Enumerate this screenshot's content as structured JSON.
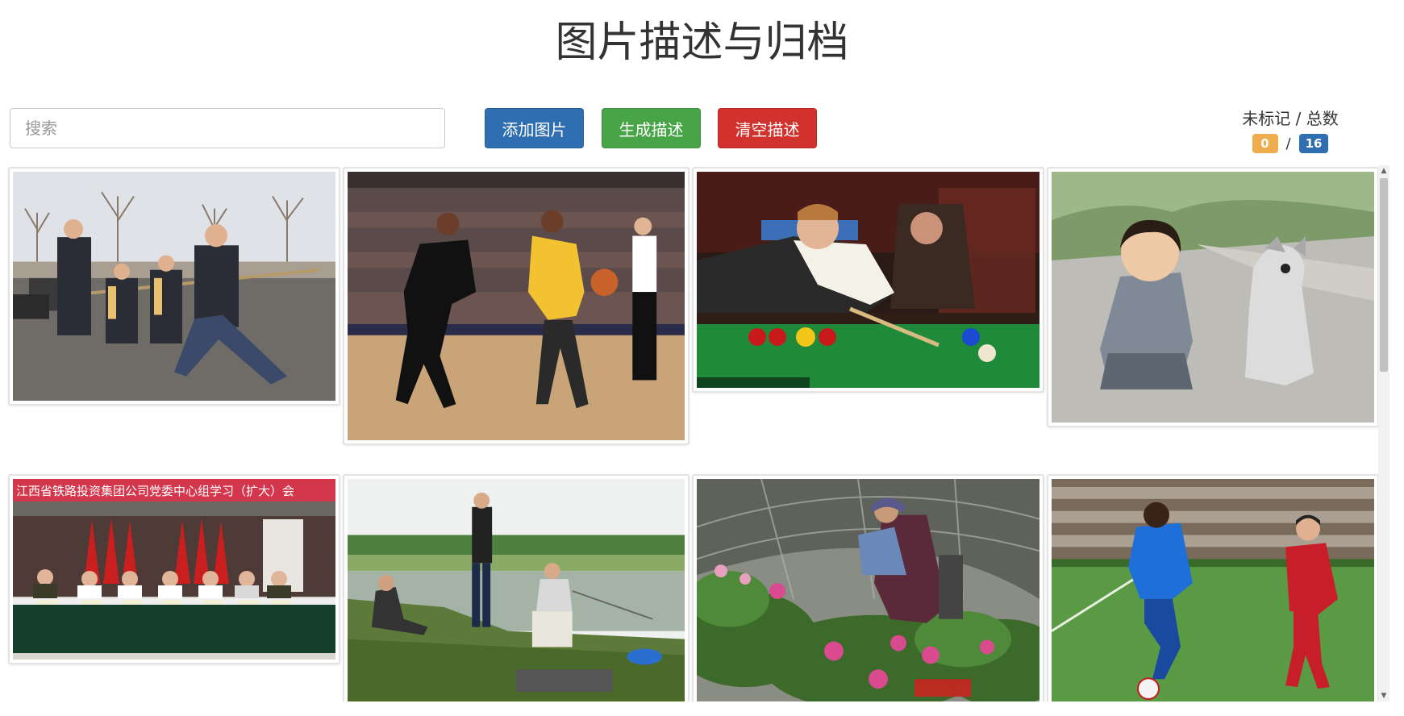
{
  "app": {
    "title": "图片描述与归档"
  },
  "toolbar": {
    "search_placeholder": "搜索",
    "add_label": "添加图片",
    "generate_label": "生成描述",
    "clear_label": "清空描述"
  },
  "counter": {
    "label": "未标记 / 总数",
    "unmarked": "0",
    "separator": "/",
    "total": "16"
  },
  "colors": {
    "add_button": "#2f6eb0",
    "generate_button": "#47a447",
    "clear_button": "#d2322d",
    "badge_unmarked": "#f0ad4e",
    "badge_total": "#2f6eb0"
  },
  "thumbnails": [
    {
      "subject": "tug-of-war"
    },
    {
      "subject": "basketball"
    },
    {
      "subject": "snooker"
    },
    {
      "subject": "child-with-dog"
    },
    {
      "subject": "meeting",
      "banner": "江西省铁路投资集团公司党委中心组学习（扩大）会"
    },
    {
      "subject": "fishing"
    },
    {
      "subject": "greenhouse-flowers"
    },
    {
      "subject": "football"
    }
  ]
}
